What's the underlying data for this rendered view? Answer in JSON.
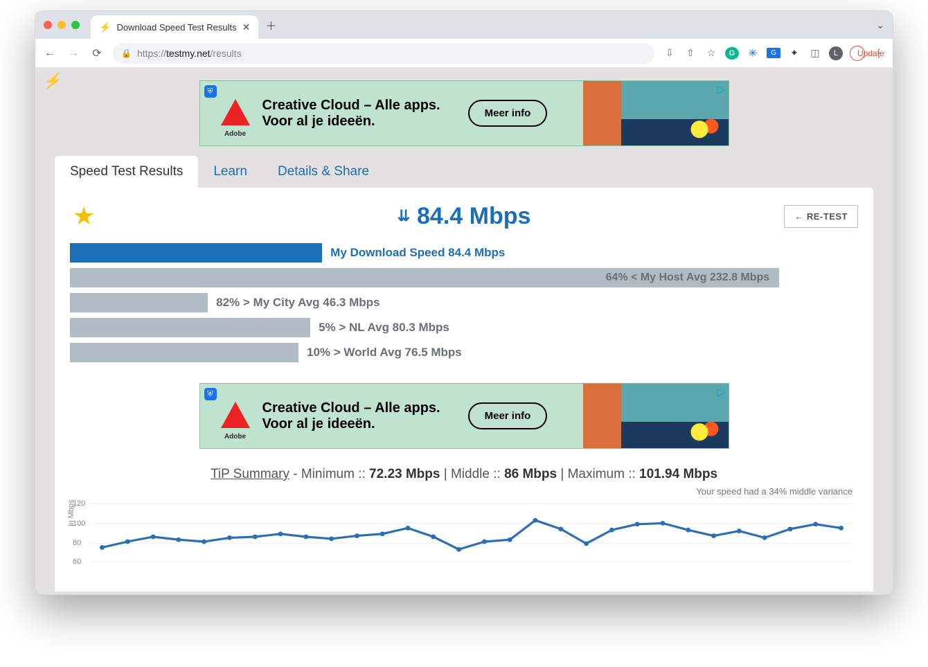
{
  "browser": {
    "tab_title": "Download Speed Test Results",
    "url_scheme": "https://",
    "url_host": "testmy.net",
    "url_path": "/results",
    "update_label": "Update",
    "avatar_letter": "L"
  },
  "ad": {
    "brand": "Adobe",
    "line1": "Creative Cloud – Alle apps.",
    "line2": "Voor al je ideeën.",
    "cta": "Meer info"
  },
  "tabs": {
    "results": "Speed Test Results",
    "learn": "Learn",
    "details": "Details & Share"
  },
  "result": {
    "big_speed": "84.4 Mbps",
    "retest": "← RE-TEST"
  },
  "bars": {
    "my": "My Download Speed 84.4 Mbps",
    "host": "64% < My Host Avg 232.8 Mbps",
    "city": "82% > My City Avg 46.3 Mbps",
    "country": "5% > NL Avg 80.3 Mbps",
    "world": "10% > World Avg 76.5 Mbps"
  },
  "tip": {
    "label": "TiP Summary",
    "min_lbl": " - Minimum :: ",
    "min_val": "72.23 Mbps",
    "mid_lbl": " | Middle :: ",
    "mid_val": "86 Mbps",
    "max_lbl": " | Maximum :: ",
    "max_val": "101.94 Mbps",
    "variance": "Your speed had a 34% middle variance"
  },
  "chart_data": {
    "type": "line",
    "ylabel": "in Mbps",
    "ylim": [
      50,
      125
    ],
    "yticks": [
      60,
      80,
      100,
      120
    ],
    "x": [
      1,
      2,
      3,
      4,
      5,
      6,
      7,
      8,
      9,
      10,
      11,
      12,
      13,
      14,
      15,
      16,
      17,
      18,
      19,
      20,
      21,
      22,
      23,
      24,
      25
    ],
    "values": [
      74,
      80,
      85,
      82,
      80,
      84,
      85,
      88,
      85,
      83,
      86,
      88,
      94,
      85,
      72,
      80,
      82,
      102,
      93,
      78,
      92,
      98,
      99,
      92,
      86,
      91,
      84,
      93,
      98,
      94
    ]
  }
}
